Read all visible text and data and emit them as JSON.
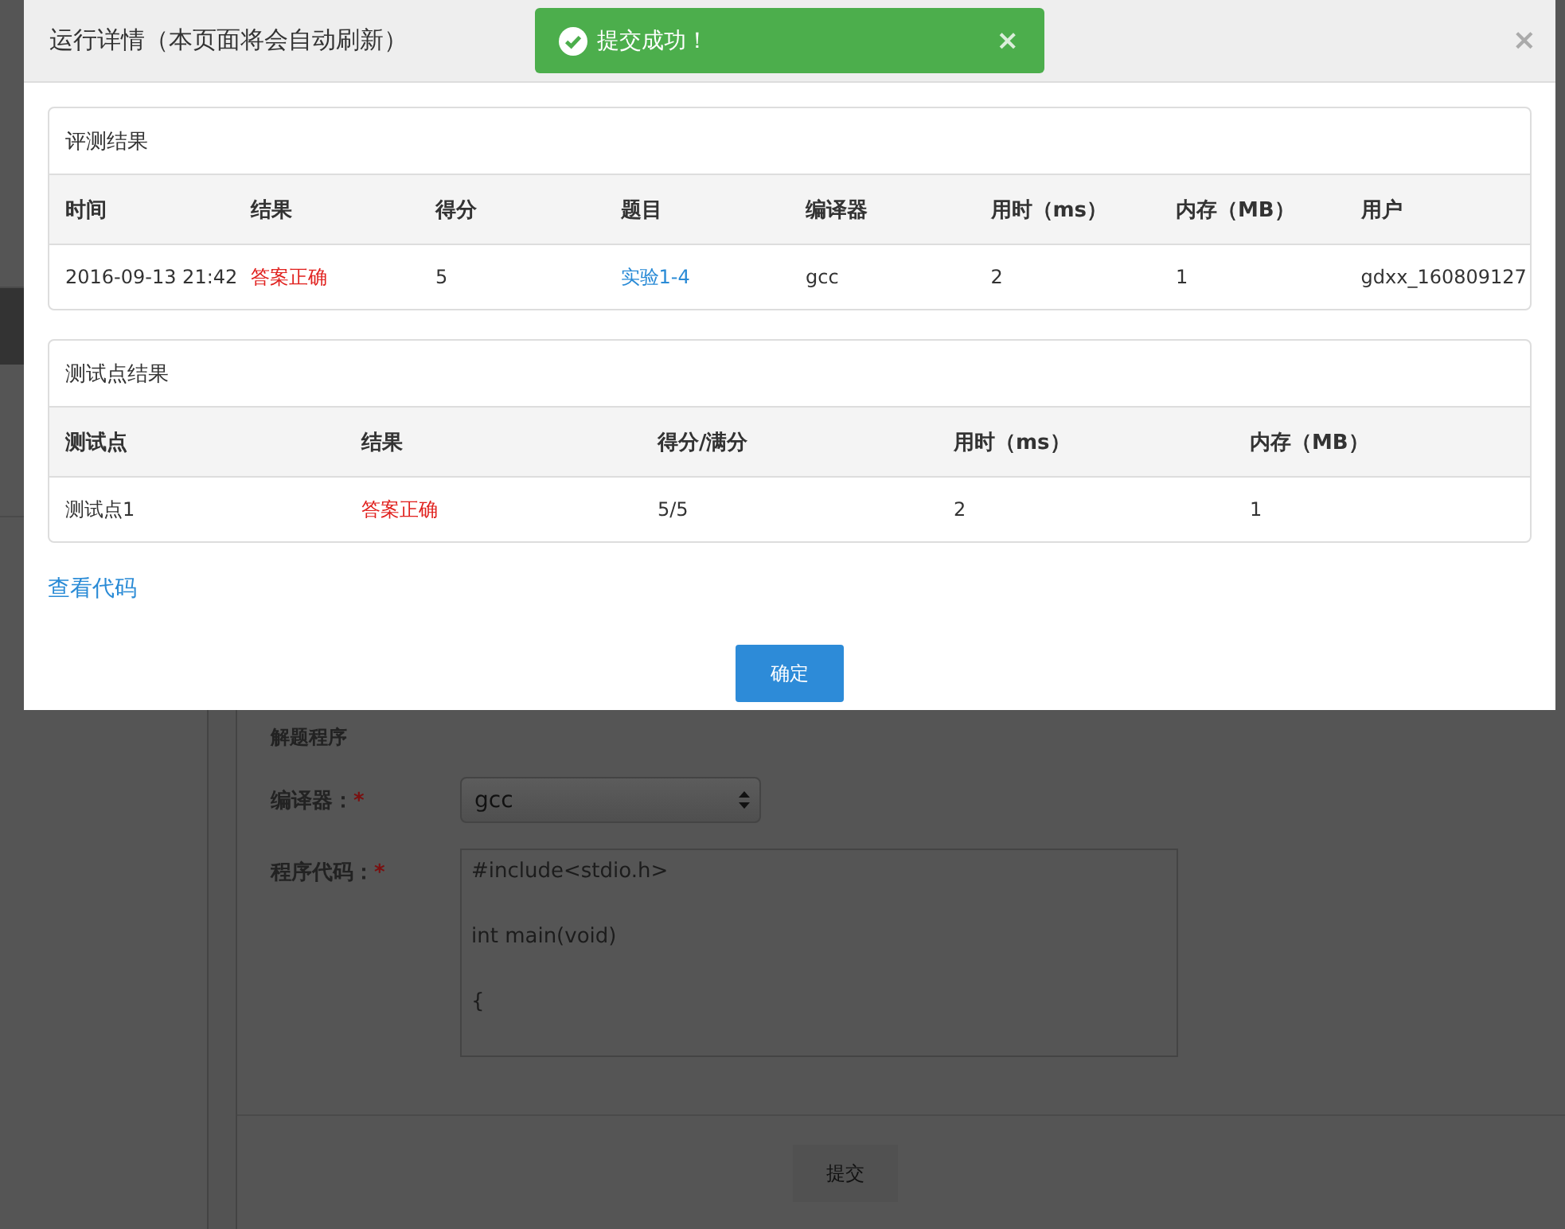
{
  "background_page": {
    "sidebar": {
      "items": [
        {
          "selected": true
        },
        {
          "selected": false
        }
      ]
    },
    "form": {
      "heading": "解题程序",
      "fields": [
        {
          "kind": "select",
          "label": "编译器：",
          "required_mark": "*",
          "value": "gcc"
        },
        {
          "kind": "code",
          "label": "程序代码：",
          "required_mark": "*",
          "lines": [
            "#include<stdio.h>",
            "int main(void)",
            "{"
          ]
        }
      ],
      "submit": "提交"
    }
  },
  "toast": {
    "message": "提交成功！",
    "close": "×"
  },
  "modal": {
    "title": "运行详情（本页面将会自动刷新）",
    "close": "×",
    "panels": [
      {
        "title": "评测结果",
        "columns": [
          "时间",
          "结果",
          "得分",
          "题目",
          "编译器",
          "用时（ms）",
          "内存（MB）",
          "用户"
        ],
        "rows": [
          [
            {
              "kind": "text",
              "text": "2016-09-13 21:42"
            },
            {
              "kind": "status",
              "text": "答案正确"
            },
            {
              "kind": "text",
              "text": "5"
            },
            {
              "kind": "link",
              "text": "实验1-4"
            },
            {
              "kind": "text",
              "text": "gcc"
            },
            {
              "kind": "text",
              "text": "2"
            },
            {
              "kind": "text",
              "text": "1"
            },
            {
              "kind": "text",
              "text": "gdxx_160809127"
            }
          ]
        ]
      },
      {
        "title": "测试点结果",
        "columns": [
          "测试点",
          "结果",
          "得分/满分",
          "用时（ms）",
          "内存（MB）"
        ],
        "rows": [
          [
            {
              "kind": "text",
              "text": "测试点1"
            },
            {
              "kind": "status",
              "text": "答案正确"
            },
            {
              "kind": "text",
              "text": "5/5"
            },
            {
              "kind": "text",
              "text": "2"
            },
            {
              "kind": "text",
              "text": "1"
            }
          ]
        ]
      }
    ],
    "link": "查看代码",
    "ok_button": "确定"
  }
}
